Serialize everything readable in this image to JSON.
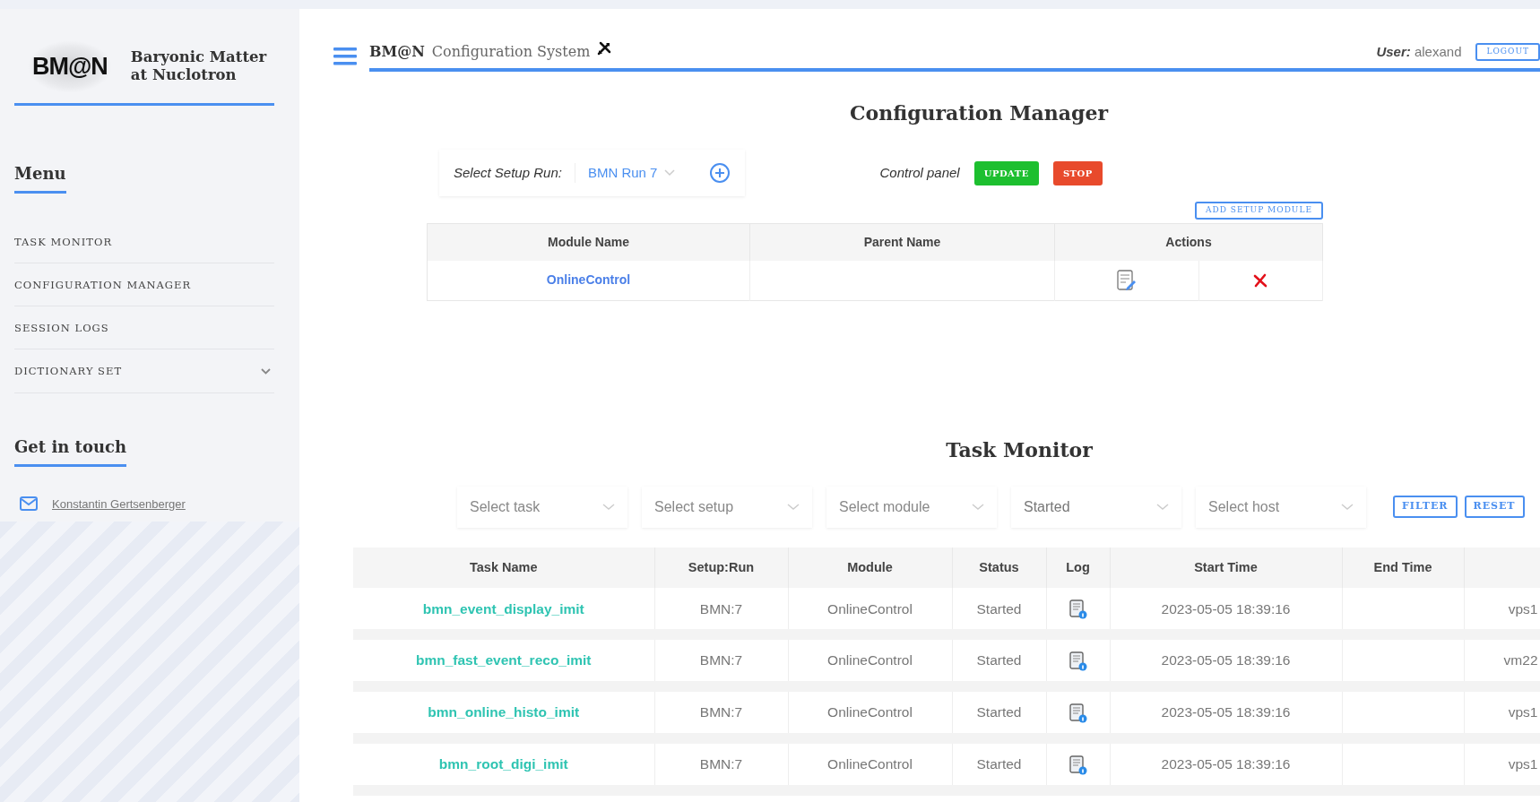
{
  "sidebar": {
    "logo_text": "BM@N",
    "title_lines": [
      "Baryonic Matter",
      "at Nuclotron"
    ],
    "menu_heading": "Menu",
    "menu_items": [
      {
        "label": "TASK MONITOR",
        "has_submenu": false
      },
      {
        "label": "CONFIGURATION MANAGER",
        "has_submenu": false
      },
      {
        "label": "SESSION LOGS",
        "has_submenu": false
      },
      {
        "label": "DICTIONARY SET",
        "has_submenu": true
      }
    ],
    "contact_heading": "Get in touch",
    "contacts": [
      {
        "name": "Konstantin Gertsenberger"
      }
    ]
  },
  "header": {
    "brand": "BM@N",
    "title": "Configuration System",
    "user_label": "User:",
    "user": "alexand",
    "logout": "LOGOUT"
  },
  "config_manager": {
    "title": "Configuration Manager",
    "setup_label": "Select Setup Run:",
    "setup_value": "BMN Run 7",
    "control_label": "Control panel",
    "buttons": [
      {
        "label": "UPDATE",
        "kind": "success"
      },
      {
        "label": "STOP",
        "kind": "danger"
      }
    ],
    "add_button": "ADD SETUP MODULE",
    "table": {
      "columns": [
        "Module Name",
        "Parent Name",
        "Actions"
      ],
      "rows": [
        {
          "module_name": "OnlineControl"
        }
      ]
    }
  },
  "task_monitor": {
    "title": "Task Monitor",
    "filters": [
      {
        "placeholder": "Select task"
      },
      {
        "placeholder": "Select setup"
      },
      {
        "placeholder": "Select module"
      },
      {
        "value": "Started"
      },
      {
        "placeholder": "Select host"
      }
    ],
    "buttons": [
      "FILTER",
      "RESET"
    ],
    "table": {
      "columns": [
        "Task Name",
        "Setup:Run",
        "Module",
        "Status",
        "Log",
        "Start Time",
        "End Time"
      ],
      "rows": [
        {
          "task_name": "bmn_event_display_imit",
          "setup_run": "BMN:7",
          "module": "OnlineControl",
          "status": "Started",
          "start_time": "2023-05-05 18:39:16",
          "column_8": "vps1"
        },
        {
          "task_name": "bmn_fast_event_reco_imit",
          "setup_run": "BMN:7",
          "module": "OnlineControl",
          "status": "Started",
          "start_time": "2023-05-05 18:39:16",
          "column_8": "vm22"
        },
        {
          "task_name": "bmn_online_histo_imit",
          "setup_run": "BMN:7",
          "module": "OnlineControl",
          "status": "Started",
          "start_time": "2023-05-05 18:39:16",
          "column_8": "vps1"
        },
        {
          "task_name": "bmn_root_digi_imit",
          "setup_run": "BMN:7",
          "module": "OnlineControl",
          "status": "Started",
          "start_time": "2023-05-05 18:39:16",
          "column_8": "vps1"
        }
      ]
    }
  }
}
